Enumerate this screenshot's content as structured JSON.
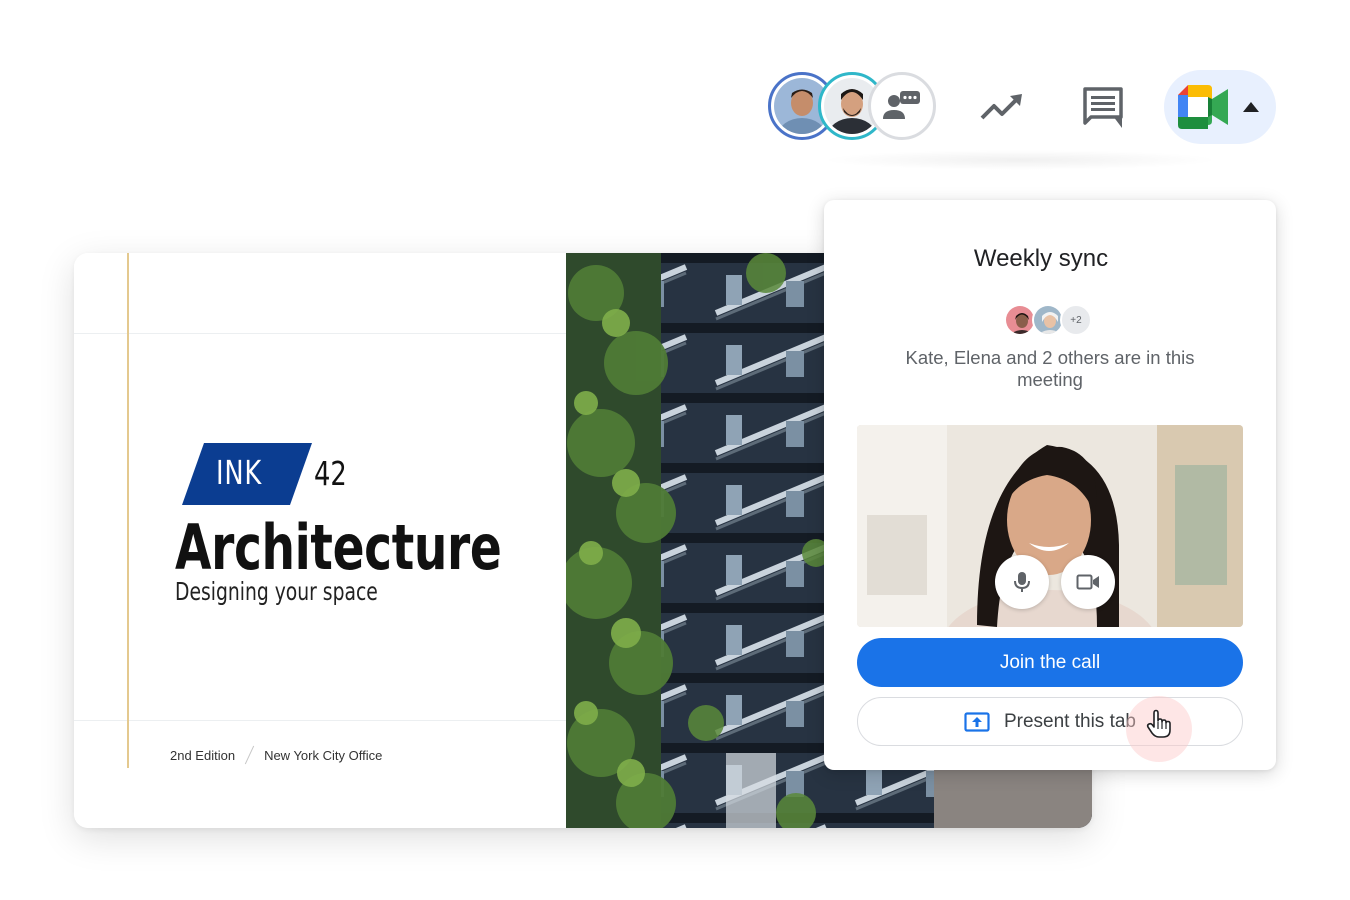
{
  "toolbar": {
    "avatars": [
      {
        "name": "participant-avatar-1",
        "ring": "#4a73c8"
      },
      {
        "name": "participant-avatar-2",
        "ring": "#2fb7c9"
      },
      {
        "name": "participant-avatar-3",
        "icon": "speaking-person-icon"
      }
    ],
    "icons": [
      "trending-up-icon",
      "chat-icon",
      "google-meet-icon",
      "caret-up-icon"
    ]
  },
  "slide": {
    "badge": "INK",
    "badge_number": "42",
    "title": "Architecture",
    "subtitle": "Designing your space",
    "edition": "2nd Edition",
    "office": "New York City Office",
    "badge_color": "#0b3d91",
    "rule_color": "#e4c98f"
  },
  "meet_popup": {
    "title": "Weekly sync",
    "more_count": "+2",
    "description": "Kate, Elena and 2 others are in this meeting",
    "join_label": "Join the call",
    "present_label": "Present this tab",
    "accent": "#1a73e8",
    "controls": [
      "microphone-icon",
      "camera-icon"
    ]
  }
}
